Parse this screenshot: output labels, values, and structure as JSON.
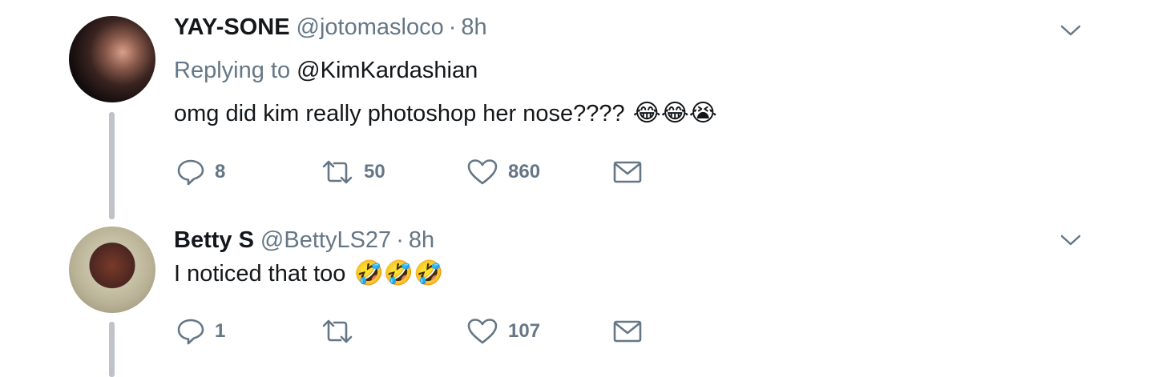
{
  "tweets": [
    {
      "name": "YAY-SONE",
      "handle": "@jotomasloco",
      "separator": "·",
      "time": "8h",
      "replying_prefix": "Replying to",
      "replying_mention": "@KimKardashian",
      "text": "omg did kim really photoshop her nose????",
      "emojis": "😂😂😭",
      "actions": {
        "replies": "8",
        "retweets": "50",
        "likes": "860"
      }
    },
    {
      "name": "Betty S",
      "handle": "@BettyLS27",
      "separator": "·",
      "time": "8h",
      "text": "I noticed that too",
      "emojis": "🤣🤣🤣",
      "actions": {
        "replies": "1",
        "retweets": "",
        "likes": "107"
      }
    }
  ],
  "icons": {
    "reply": "reply-icon",
    "retweet": "retweet-icon",
    "like": "heart-icon",
    "message": "envelope-icon",
    "more": "chevron-down-icon"
  },
  "colors": {
    "secondary_text": "#657786",
    "primary_text": "#14171a",
    "thread_line": "#bfc3c7"
  }
}
